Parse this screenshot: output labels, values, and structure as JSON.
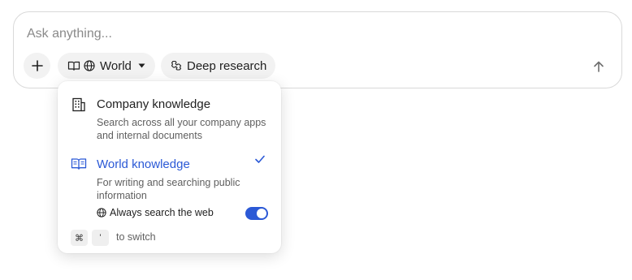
{
  "composer": {
    "placeholder": "Ask anything...",
    "source_label": "World",
    "deep_research_label": "Deep research"
  },
  "source_menu": {
    "options": [
      {
        "title": "Company knowledge",
        "description": "Search across all your company apps and internal documents",
        "icon": "building-icon",
        "selected": false
      },
      {
        "title": "World knowledge",
        "description": "For writing and searching public information",
        "icon": "book-icon",
        "selected": true
      }
    ],
    "always_search_web": {
      "label": "Always search the web",
      "enabled": true
    },
    "shortcut": {
      "keys": [
        "⌘",
        "'"
      ],
      "hint": "to switch"
    }
  },
  "colors": {
    "accent": "#2b59d6",
    "pill_background": "#f2f2f2",
    "border": "#d9d9d9"
  }
}
